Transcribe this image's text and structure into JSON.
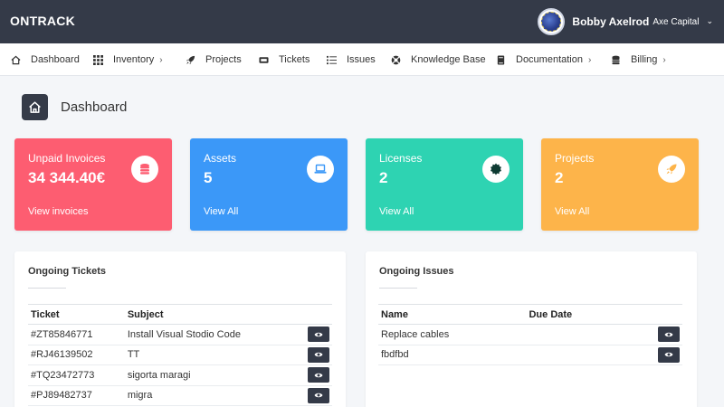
{
  "app": {
    "brand": "ONTRACK"
  },
  "user": {
    "name": "Bobby Axelrod",
    "company": "Axe Capital"
  },
  "nav": {
    "items": [
      {
        "label": "Dashboard",
        "icon": "home-icon",
        "chevron": ""
      },
      {
        "label": "Inventory",
        "icon": "grid-icon",
        "chevron": "›"
      },
      {
        "label": "Projects",
        "icon": "rocket-icon",
        "chevron": ""
      },
      {
        "label": "Tickets",
        "icon": "ticket-icon",
        "chevron": ""
      },
      {
        "label": "Issues",
        "icon": "list-icon",
        "chevron": ""
      },
      {
        "label": "Knowledge Base",
        "icon": "lifebuoy-icon",
        "chevron": ""
      },
      {
        "label": "Documentation",
        "icon": "book-icon",
        "chevron": "›"
      },
      {
        "label": "Billing",
        "icon": "coins-icon",
        "chevron": "›"
      }
    ]
  },
  "page": {
    "title": "Dashboard"
  },
  "cards": [
    {
      "title": "Unpaid Invoices",
      "value": "34 344.40€",
      "link": "View invoices",
      "icon": "coins-icon",
      "color": "#fd5d71"
    },
    {
      "title": "Assets",
      "value": "5",
      "link": "View All",
      "icon": "laptop-icon",
      "color": "#3b98f8"
    },
    {
      "title": "Licenses",
      "value": "2",
      "link": "View All",
      "icon": "certificate-icon",
      "color": "#2ed3b2"
    },
    {
      "title": "Projects",
      "value": "2",
      "link": "View All",
      "icon": "rocket-icon",
      "color": "#fdb44a"
    }
  ],
  "tickets": {
    "title": "Ongoing Tickets",
    "headers": [
      "Ticket",
      "Subject"
    ],
    "rows": [
      {
        "id": "#ZT85846771",
        "subject": "Install Visual Stodio Code"
      },
      {
        "id": "#RJ46139502",
        "subject": "TT"
      },
      {
        "id": "#TQ23472773",
        "subject": "sigorta maragi"
      },
      {
        "id": "#PJ89482737",
        "subject": "migra"
      }
    ]
  },
  "issues": {
    "title": "Ongoing Issues",
    "headers": [
      "Name",
      "Due Date"
    ],
    "rows": [
      {
        "name": "Replace cables",
        "due": ""
      },
      {
        "name": "fbdfbd",
        "due": ""
      }
    ]
  }
}
